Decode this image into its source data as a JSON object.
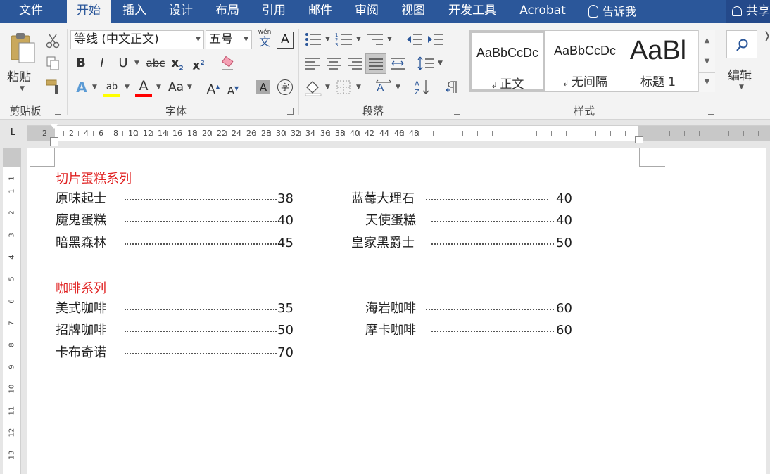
{
  "tabs": {
    "file": "文件",
    "home": "开始",
    "insert": "插入",
    "design": "设计",
    "layout": "布局",
    "references": "引用",
    "mailings": "邮件",
    "review": "审阅",
    "view": "视图",
    "developer": "开发工具",
    "acrobat": "Acrobat"
  },
  "tell_me": "告诉我",
  "share": "共享",
  "ribbon": {
    "clipboard": {
      "paste_label": "粘贴",
      "group_label": "剪贴板"
    },
    "font": {
      "font_name": "等线 (中文正文)",
      "font_size": "五号",
      "group_label": "字体",
      "phonetic_label": "wén",
      "phonetic_char": "文",
      "border_char": "A",
      "bold": "B",
      "italic": "I",
      "underline": "U",
      "strike": "abc",
      "subscript": "x",
      "superscript": "x",
      "change_case": "Aa",
      "grow": "A",
      "shrink": "A",
      "char_shade": "A",
      "enclose": "字",
      "highlight": "ab",
      "font_color": "A",
      "highlight_color": "#ffff00",
      "font_color_value": "#ff0000"
    },
    "paragraph": {
      "group_label": "段落"
    },
    "styles": {
      "group_label": "样式",
      "items": [
        {
          "sample": "AaBbCcDc",
          "name": "正文"
        },
        {
          "sample": "AaBbCcDc",
          "name": "无间隔"
        },
        {
          "sample": "AaBl",
          "name": "标题 1"
        }
      ]
    },
    "editing": {
      "label": "编辑"
    }
  },
  "ruler": {
    "h_numbers": [
      "2",
      "2",
      "4",
      "6",
      "8",
      "10",
      "12",
      "14",
      "16",
      "18",
      "20",
      "22",
      "24",
      "26",
      "28",
      "30",
      "32",
      "34",
      "36",
      "38",
      "40",
      "42",
      "44",
      "46",
      "48"
    ],
    "v_numbers": [
      "1",
      "1",
      "2",
      "3",
      "4",
      "5",
      "6",
      "7",
      "8",
      "9",
      "10",
      "11",
      "12",
      "13"
    ],
    "tab_selector": "L"
  },
  "document": {
    "section1": {
      "heading": "切片蛋糕系列",
      "left": [
        {
          "name": "原味起士",
          "price": "38"
        },
        {
          "name": "魔鬼蛋糕",
          "price": "40"
        },
        {
          "name": "暗黑森林",
          "price": "45"
        }
      ],
      "right": [
        {
          "name": "蓝莓大理石",
          "price": "40"
        },
        {
          "name": "天使蛋糕",
          "price": "40"
        },
        {
          "name": "皇家黑爵士",
          "price": "50"
        }
      ]
    },
    "section2": {
      "heading": "咖啡系列",
      "left": [
        {
          "name": "美式咖啡",
          "price": "35"
        },
        {
          "name": "招牌咖啡",
          "price": "50"
        },
        {
          "name": "卡布奇诺",
          "price": "70"
        }
      ],
      "right": [
        {
          "name": "海岩咖啡",
          "price": "60"
        },
        {
          "name": "摩卡咖啡",
          "price": "60"
        }
      ]
    }
  }
}
